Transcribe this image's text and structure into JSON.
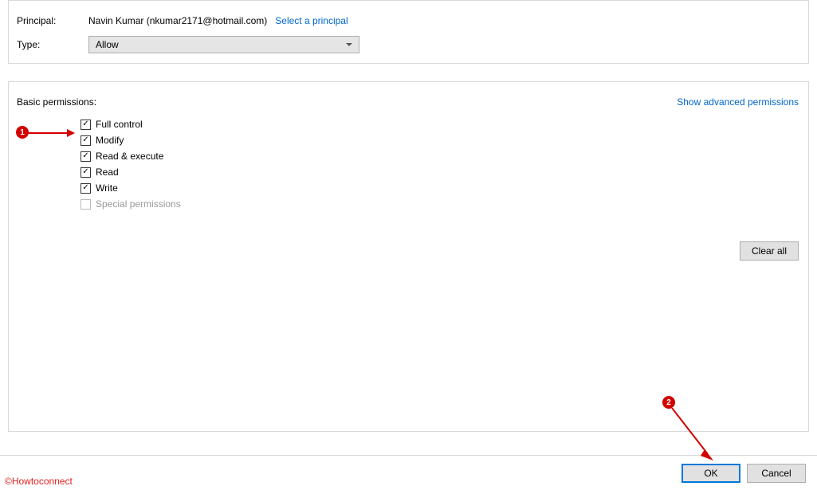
{
  "top": {
    "principalLabel": "Principal:",
    "principalValue": "Navin Kumar (nkumar2171@hotmail.com)",
    "selectPrincipalLink": "Select a principal",
    "typeLabel": "Type:",
    "typeValue": "Allow"
  },
  "permissions": {
    "heading": "Basic permissions:",
    "showAdvanced": "Show advanced permissions",
    "clearAll": "Clear all",
    "items": [
      {
        "label": "Full control",
        "checked": true,
        "enabled": true
      },
      {
        "label": "Modify",
        "checked": true,
        "enabled": true
      },
      {
        "label": "Read & execute",
        "checked": true,
        "enabled": true
      },
      {
        "label": "Read",
        "checked": true,
        "enabled": true
      },
      {
        "label": "Write",
        "checked": true,
        "enabled": true
      },
      {
        "label": "Special permissions",
        "checked": false,
        "enabled": false
      }
    ]
  },
  "footer": {
    "ok": "OK",
    "cancel": "Cancel"
  },
  "annotations": {
    "badge1": "1",
    "badge2": "2",
    "watermark": "©Howtoconnect"
  }
}
